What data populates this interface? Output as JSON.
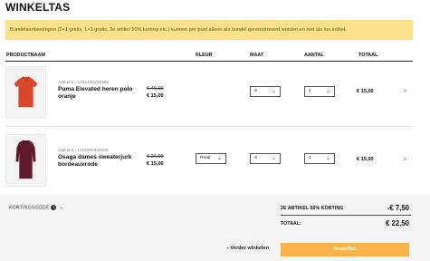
{
  "page": {
    "title": "WINKELTAS"
  },
  "notice": {
    "text": "Bundelaanbiedingen (2+1 gratis, 1+1 gratis, 2e artikel 50% korting etc.) kunnen per post alleen als bundel geretourneerd worden en niet als los artikel."
  },
  "table": {
    "headers": {
      "product": "PRODUCTNAAM",
      "color": "KLEUR",
      "size": "MAAT",
      "qty": "AANTAL",
      "total": "TOTAAL"
    }
  },
  "items": [
    {
      "article": "Artikelnr.: 1255180231050",
      "name": "Puma Elevated heren polo oranje",
      "price_old": "€ 49,99",
      "price_new": "€ 15,00",
      "color": "",
      "size": "S",
      "qty": "1",
      "total": "€ 15,00",
      "remove_icon": "×",
      "thumb_color": "#d9472b"
    },
    {
      "article": "Artikelnr.: 1194080434009",
      "name": "Osaga dames sweaterjurk bordeauxrode",
      "price_old": "€ 24,99",
      "price_new": "€ 15,00",
      "color": "Rood",
      "size": "S",
      "qty": "1",
      "total": "€ 15,00",
      "remove_icon": "×",
      "thumb_color": "#5e1a2a"
    }
  ],
  "discount": {
    "label": "KORTINGSCODE",
    "info_icon": "i",
    "chevron": "⌄"
  },
  "summary": {
    "discount_label": "2E ARTIKEL 50% KORTING",
    "discount_value": "-€ 7,50",
    "total_label": "TOTAAL:",
    "total_value": "€ 22,50"
  },
  "actions": {
    "back": "‹  Verder winkelen",
    "checkout": "Bestellen"
  },
  "colors": {
    "accent": "#f8b44b",
    "notice_bg": "#fbe28a"
  }
}
